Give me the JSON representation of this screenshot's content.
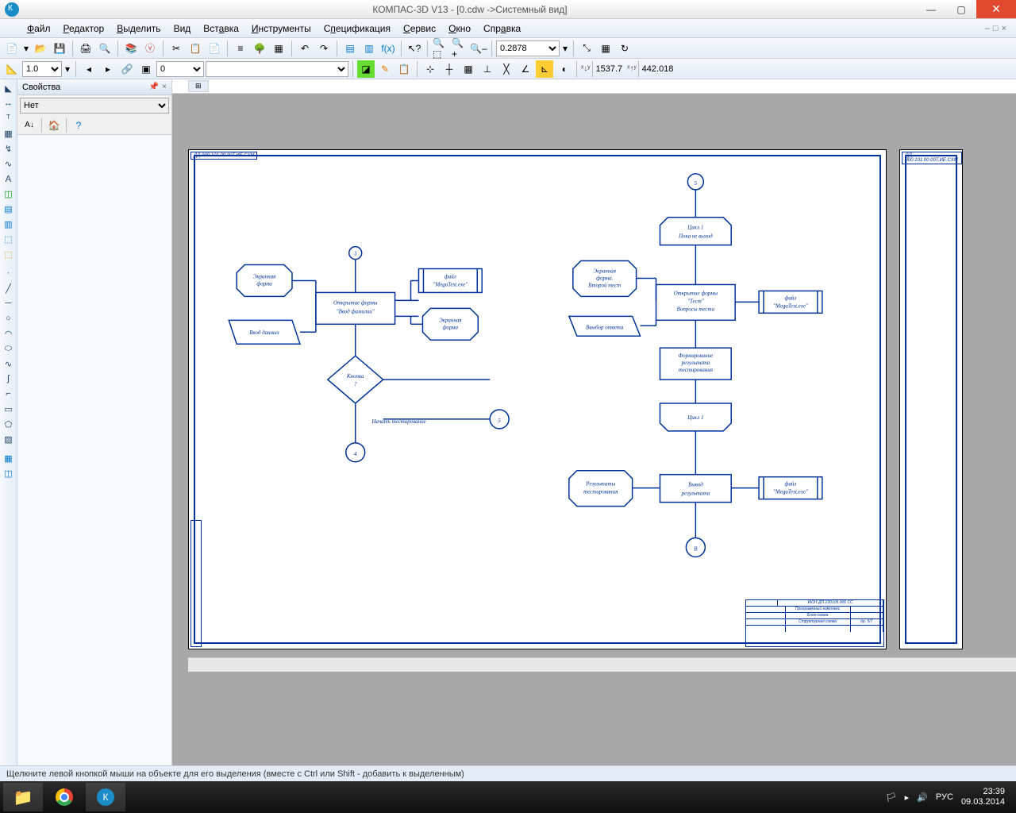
{
  "title": "КОМПАС-3D V13 - [0.cdw ->Системный вид]",
  "menu": {
    "file": "Файл",
    "edit": "Редактор",
    "select": "Выделить",
    "view": "Вид",
    "insert": "Вставка",
    "tools": "Инструменты",
    "spec": "Спецификация",
    "service": "Сервис",
    "window": "Окно",
    "help": "Справка"
  },
  "toolbar2": {
    "scale": "1.0",
    "style_num": "0",
    "style_name": "",
    "zoom": "0.2878",
    "coord_x": "1537.7",
    "coord_y": "442.018"
  },
  "props": {
    "title": "Свойства",
    "combo": "Нет"
  },
  "flow": {
    "screen_form": "Экранная\nформа",
    "input_data": "Ввод данных",
    "conn3": "3",
    "open_form": "Открытие формы\n\"Ввод фамилии\"",
    "file_mega": "файл\n\"MegaTest.exe\"",
    "button_q": "Кнопка\n?",
    "start_test": "Начать тестирование",
    "conn5": "5",
    "conn4": "4",
    "cycle1_head": "Цикл 1\nПока не выход",
    "screen_form2": "Экранная\nформа.\nВторой тест",
    "open_test": "Открытие формы\n\"Тест\"\nВопросы теста",
    "choose_ans": "Ввыбор ответа",
    "form_result": "Формирование\nрезультата\nтестирования",
    "cycle1_end": "Цикл 1",
    "test_results": "Результаты\nтестирования",
    "output_result": "Вывод\nрезультата",
    "conn_v": "В"
  },
  "stamp": {
    "tl": "ДД 900.101.00.00Т.ИЕ.СХМ",
    "code": "ККЭТ.ДП.230105.006 СС",
    "r1": "Программный комплекс",
    "r2": "Блок-схема",
    "r3": "Структурная схема",
    "sheet": "др. 5/7"
  },
  "status": "Щелкните левой кнопкой мыши на объекте для его выделения (вместе с Ctrl или Shift - добавить к выделенным)",
  "tray": {
    "lang": "РУС",
    "time": "23:39",
    "date": "09.03.2014"
  }
}
